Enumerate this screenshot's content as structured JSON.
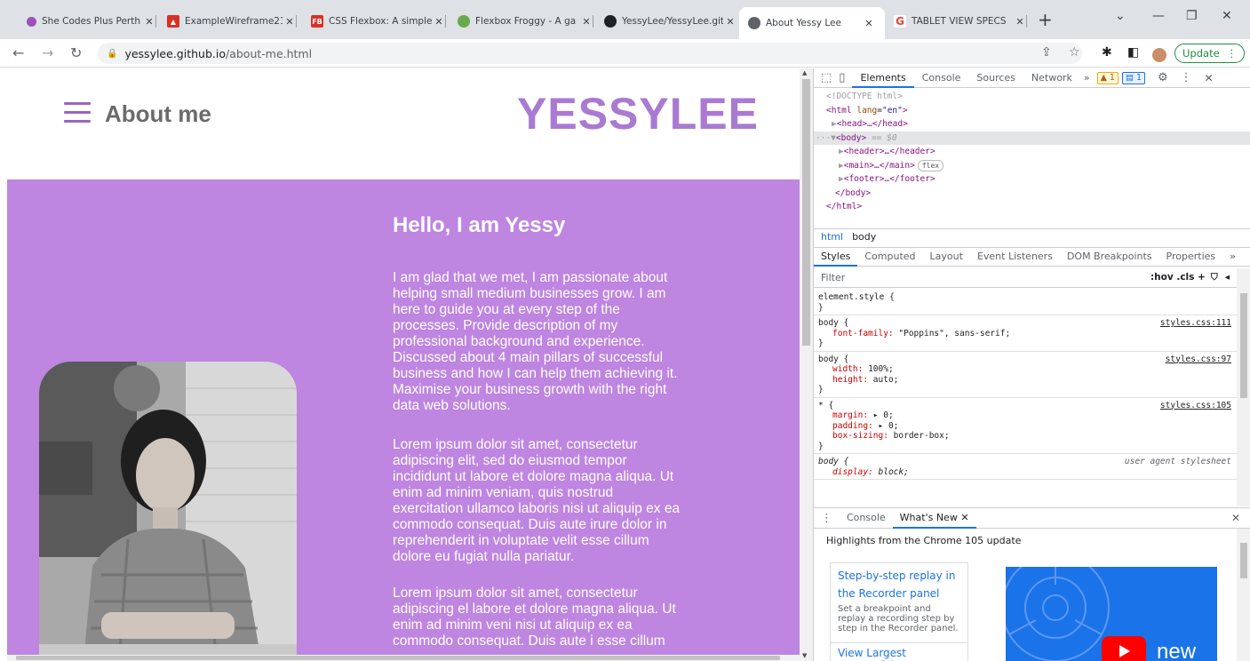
{
  "browser": {
    "tabs": [
      {
        "title": "She Codes Plus Perth",
        "icon": "she-codes-icon",
        "color": "#9c51b6",
        "active": false
      },
      {
        "title": "ExampleWireframe21",
        "icon": "pdf-icon",
        "color": "#d93025",
        "active": false
      },
      {
        "title": "CSS Flexbox: A simple",
        "icon": "fb-icon",
        "color": "#d93025",
        "active": false
      },
      {
        "title": "Flexbox Froggy - A ga",
        "icon": "frog-icon",
        "color": "#6aa84f",
        "active": false
      },
      {
        "title": "YessyLee/YessyLee.git",
        "icon": "github-icon",
        "color": "#202124",
        "active": false
      },
      {
        "title": "About Yessy Lee",
        "icon": "globe-icon",
        "color": "#5f6368",
        "active": true
      },
      {
        "title": "TABLET VIEW SPECS",
        "icon": "google-icon",
        "color": "#ea4335",
        "active": false
      }
    ],
    "address": {
      "domain": "yessylee.github.io",
      "path": "/about-me.html"
    },
    "update_label": "Update"
  },
  "page": {
    "title": "About me",
    "logo": "YESSYLEE",
    "heading": "Hello, I am Yessy",
    "paragraphs": [
      "I am glad that we met, I am passionate about helping small medium businesses grow. I am here to guide you at every step of the processes. Provide description of my professional background and experience. Discussed about 4 main pillars of successful business and how I can help them achieving it. Maximise your business growth with the right data web solutions.",
      "Lorem ipsum dolor sit amet, consectetur adipiscing elit, sed do eiusmod tempor incididunt ut labore et dolore magna aliqua. Ut enim ad minim veniam, quis nostrud exercitation ullamco laboris nisi ut aliquip ex ea commodo consequat. Duis aute irure dolor in reprehenderit in voluptate velit esse cillum dolore eu fugiat nulla pariatur.",
      "Lorem ipsum dolor sit amet, consectetur adipiscing el labore et dolore magna aliqua. Ut enim ad minim veni nisi ut aliquip ex ea commodo consequat. Duis aute i esse cillum"
    ],
    "colors": {
      "accent": "#be85e1",
      "logo": "#a97ad2",
      "menu": "#9966bf"
    }
  },
  "devtools": {
    "tabs": [
      "Elements",
      "Console",
      "Sources",
      "Network"
    ],
    "more": "»",
    "warnings": "1",
    "messages": "1",
    "dom": {
      "doctype": "<!DOCTYPE html>",
      "html_open": "<html",
      "lang_attr": "lang",
      "lang_val": "\"en\"",
      "head": "<head>…</head>",
      "body_open": "<body>",
      "body_marker": "== $0",
      "header": "<header>…</header>",
      "main": "<main>…</main>",
      "flex_badge": "flex",
      "footer": "<footer>…</footer>",
      "body_close": "</body>",
      "html_close": "</html>"
    },
    "breadcrumbs": [
      "html",
      "body"
    ],
    "style_tabs": [
      "Styles",
      "Computed",
      "Layout",
      "Event Listeners",
      "DOM Breakpoints",
      "Properties",
      "»"
    ],
    "filter_placeholder": "Filter",
    "filter_tools": ":hov .cls +",
    "rules": [
      {
        "selector": "element.style {",
        "source": "",
        "props": []
      },
      {
        "selector": "body {",
        "source": "styles.css:111",
        "props": [
          {
            "name": "font-family",
            "value": "\"Poppins\", sans-serif;"
          }
        ]
      },
      {
        "selector": "body {",
        "source": "styles.css:97",
        "props": [
          {
            "name": "width",
            "value": "100%;"
          },
          {
            "name": "height",
            "value": "auto;"
          }
        ]
      },
      {
        "selector": "* {",
        "source": "styles.css:105",
        "props": [
          {
            "name": "margin",
            "value": "▸ 0;"
          },
          {
            "name": "padding",
            "value": "▸ 0;"
          },
          {
            "name": "box-sizing",
            "value": "border-box;"
          }
        ]
      },
      {
        "selector": "body {",
        "source": "user agent stylesheet",
        "props": [
          {
            "name": "display",
            "value": "block;"
          }
        ]
      }
    ],
    "drawer_tabs": [
      "Console",
      "What's New"
    ],
    "highlights": "Highlights from the Chrome 105 update",
    "card_title": "Step-by-step replay in the Recorder panel",
    "card_desc": "Set a breakpoint and replay a recording step by step in the Recorder panel.",
    "card2_title": "View Largest Contentful",
    "promo_label": "new"
  }
}
